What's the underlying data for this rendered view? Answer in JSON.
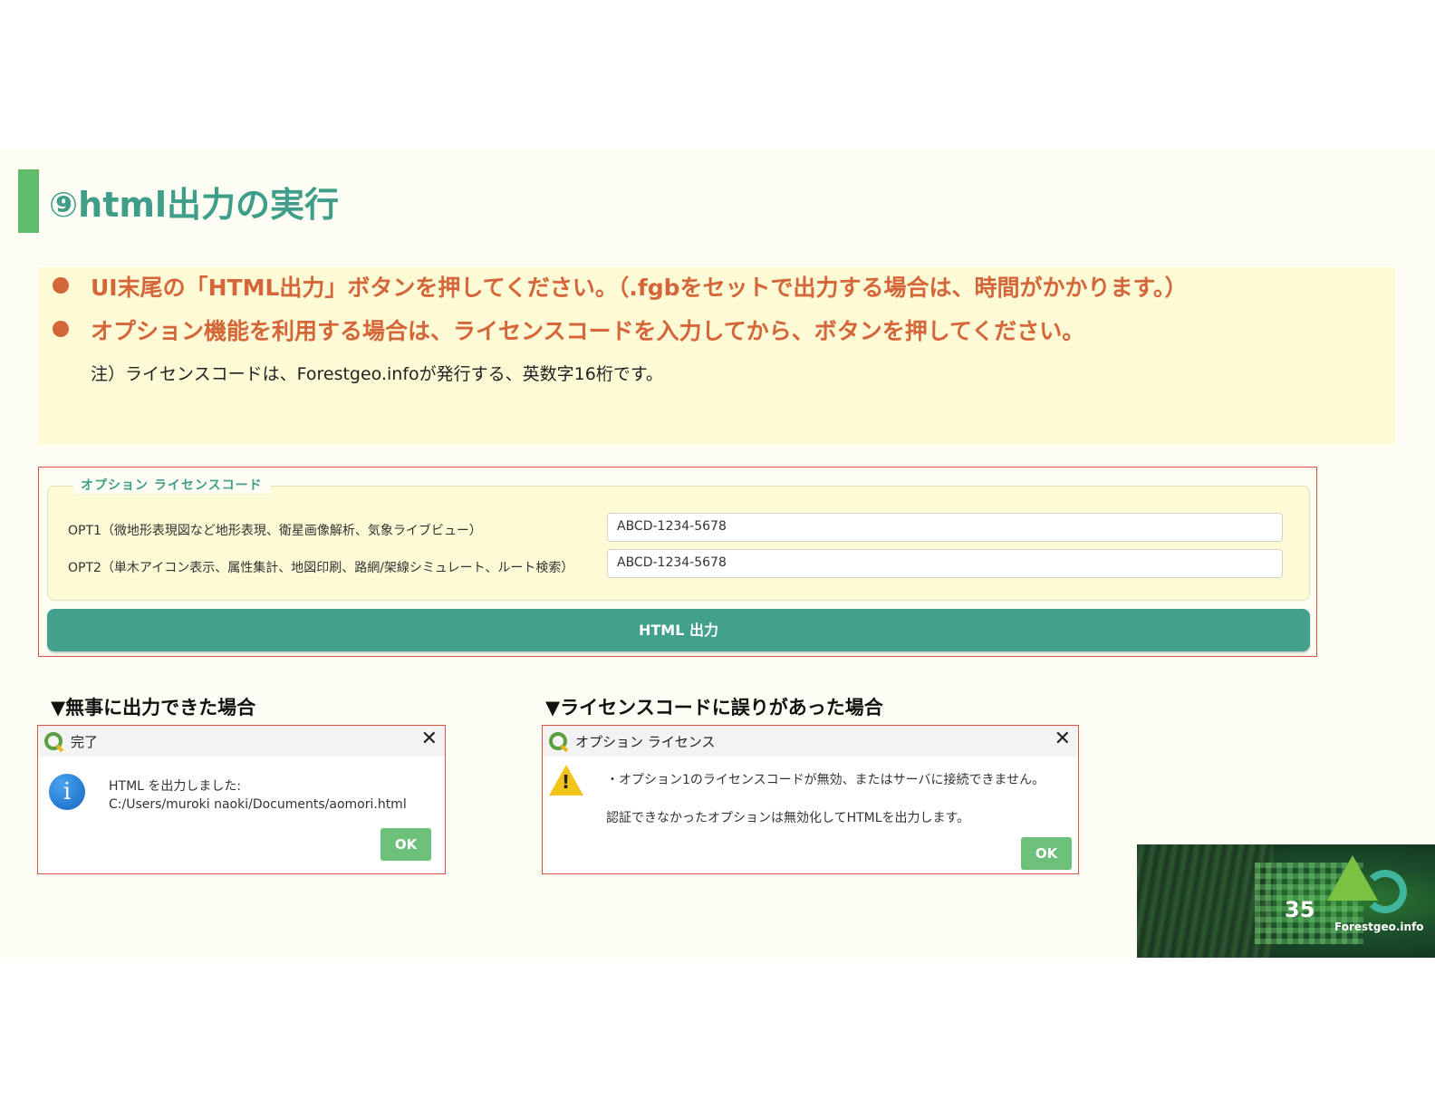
{
  "title": "⑨html出力の実行",
  "bullets": [
    "UI末尾の「HTML出力」ボタンを押してください。（.fgbをセットで出力する場合は、時間がかかります。）",
    "オプション機能を利用する場合は、ライセンスコードを入力してから、ボタンを押してください。"
  ],
  "note": "注）ライセンスコードは、Forestgeo.infoが発行する、英数字16桁です。",
  "panel": {
    "legend": "オプション ライセンスコード",
    "opt1_label": "OPT1（微地形表現図など地形表現、衛星画像解析、気象ライブビュー）",
    "opt1_value": "ABCD-1234-5678",
    "opt2_label": "OPT2（単木アイコン表示、属性集計、地図印刷、路網/架線シミュレート、ルート検索）",
    "opt2_value": "ABCD-1234-5678",
    "button_label": "HTML 出力"
  },
  "success": {
    "heading": "▼無事に出力できた場合",
    "title": "完了",
    "close": "✕",
    "line1": "HTML を出力しました:",
    "line2": "C:/Users/muroki naoki/Documents/aomori.html",
    "ok": "OK",
    "icon": "info-icon"
  },
  "error": {
    "heading": "▼ライセンスコードに誤りがあった場合",
    "title": "オプション ライセンス",
    "close": "✕",
    "line1": "・オプション1のライセンスコードが無効、またはサーバに接続できません。",
    "line2": "認証できなかったオプションは無効化してHTMLを出力します。",
    "ok": "OK",
    "icon": "warning-icon"
  },
  "footer": {
    "page_number": "35",
    "brand": "Forestgeo.info"
  },
  "colors": {
    "accent_green": "#3f9e8a",
    "bullet_orange": "#d4663a",
    "button_teal": "#43a08c",
    "border_red": "#d9533e"
  }
}
